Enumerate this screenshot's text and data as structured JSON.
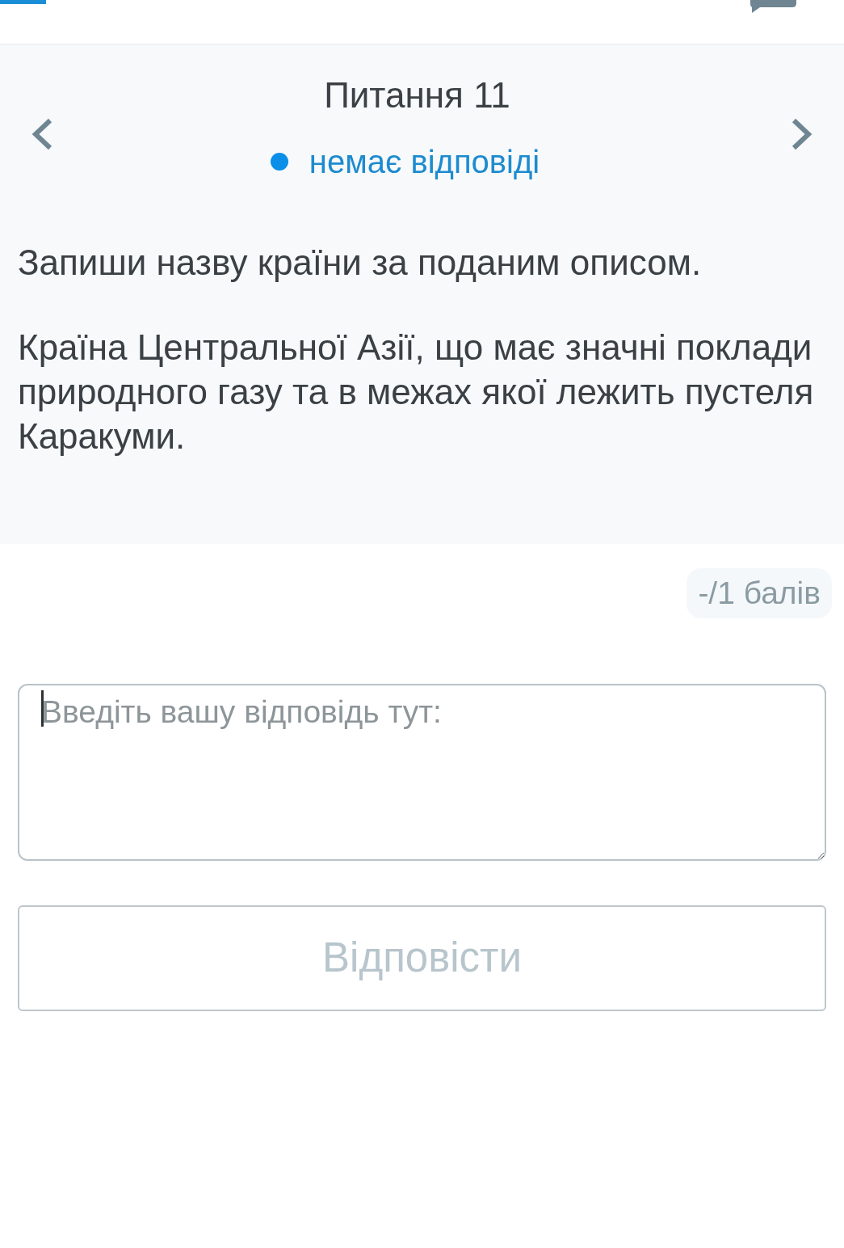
{
  "question": {
    "title": "Питання 11",
    "status": "немає відповіді",
    "prompt": "Запиши назву країни за поданим описом.",
    "description": "Країна Центральної Азії, що має значні поклади природного газу та в межах якої лежить пустеля Каракуми."
  },
  "score": "-/1 балів",
  "answer": {
    "placeholder": "Введіть вашу відповідь тут:",
    "focused": true
  },
  "submit_button": {
    "label": "Відповісти",
    "disabled": true
  }
}
